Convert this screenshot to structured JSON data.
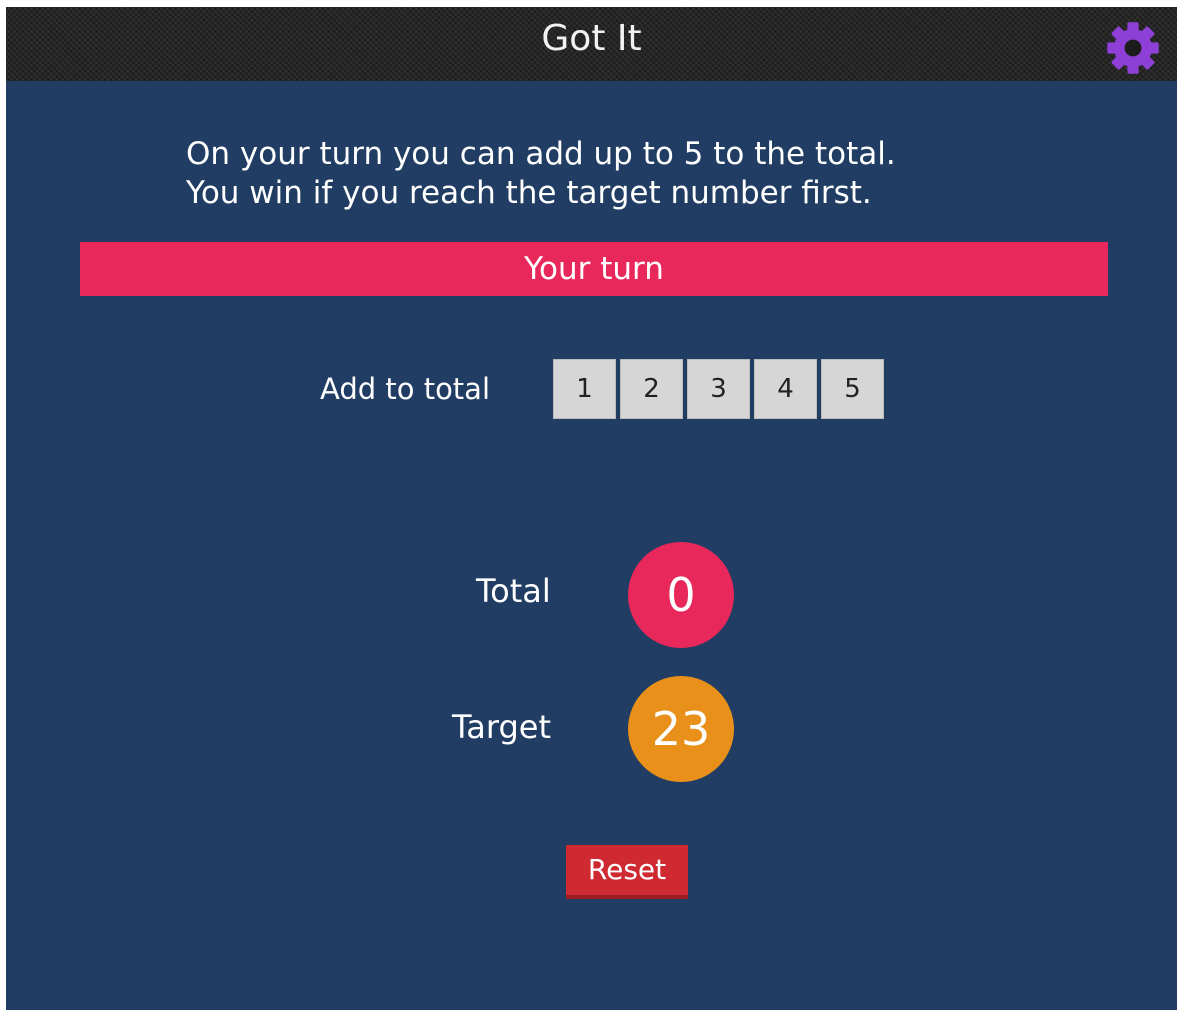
{
  "app": {
    "title": "Got It",
    "settings_icon": "gear-icon",
    "settings_icon_color": "#8e3fd6"
  },
  "instructions": {
    "line1": "On your turn you can add up to 5 to the total.",
    "line2": "You win if you reach the target number first."
  },
  "status": {
    "text": "Your turn",
    "color": "#e8285a"
  },
  "controls": {
    "add_label": "Add to total",
    "buttons": [
      "1",
      "2",
      "3",
      "4",
      "5"
    ]
  },
  "stats": {
    "total_label": "Total",
    "total_value": "0",
    "total_color": "#e8285a",
    "target_label": "Target",
    "target_value": "23",
    "target_color": "#e8901a"
  },
  "actions": {
    "reset_label": "Reset"
  },
  "colors": {
    "background": "#213d63",
    "titlebar": "#1c1c1c"
  }
}
